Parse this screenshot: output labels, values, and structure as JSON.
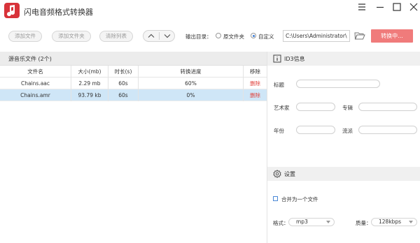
{
  "app": {
    "title": "闪电音频格式转换器"
  },
  "window": {
    "menu_icon": "hamburger-icon",
    "minimize_icon": "minimize-icon",
    "maximize_icon": "maximize-icon",
    "close_icon": "close-icon"
  },
  "toolbar": {
    "add_file": "添加文件",
    "add_folder": "添加文件夹",
    "clear_list": "清除列表",
    "output_label": "输出目录：",
    "radio_original": "原文件夹",
    "radio_custom": "自定义",
    "selected_output": "自定义",
    "path_value": "C:\\Users\\Administrator\\",
    "convert_button": "转换中..."
  },
  "list": {
    "header": "源音乐文件 (2个)",
    "columns": [
      "文件名",
      "大小(mb)",
      "时长(s)",
      "转换进度",
      "移除"
    ],
    "rows": [
      {
        "name": "Chains.aac",
        "size": "2.29 mb",
        "duration": "60s",
        "progress": "60%",
        "remove": "删除",
        "selected": false
      },
      {
        "name": "Chains.amr",
        "size": "93.79 kb",
        "duration": "60s",
        "progress": "0%",
        "remove": "删除",
        "selected": true
      }
    ]
  },
  "id3": {
    "title": "ID3信息",
    "fields": {
      "title_label": "标题",
      "artist_label": "艺术家",
      "album_label": "专辑",
      "year_label": "年份",
      "genre_label": "流派"
    }
  },
  "settings": {
    "title": "设置",
    "merge_label": "合并为一个文件",
    "merge_checked": false,
    "format_label": "格式：",
    "format_value": "mp3",
    "quality_label": "质量：",
    "quality_value": "128kbps"
  },
  "colors": {
    "accent": "#d8333a",
    "convert_button": "#f07b7b",
    "selected_row": "#cfe6f7",
    "delete_text": "#e0433d"
  }
}
